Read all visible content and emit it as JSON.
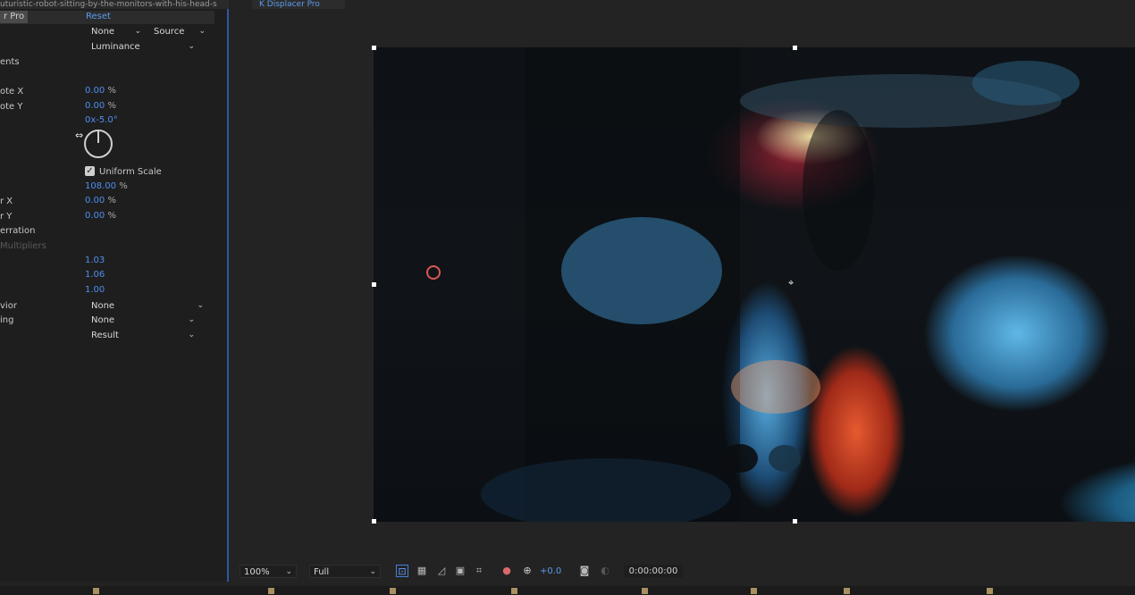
{
  "panel": {
    "filename": "uturistic-robot-sitting-by-the-monitors-with-his-head-s",
    "effect_name": "r Pro",
    "reset_label": "Reset",
    "rows": {
      "layer_select": "None",
      "layer_source": "Source",
      "channel": "Luminance",
      "section_ents": "ents",
      "rotate_x_label": "ote X",
      "rotate_x_value": "0.00",
      "rotate_y_label": "ote Y",
      "rotate_y_value": "0.00",
      "rotation_value": "0x-5.0°",
      "uniform_scale_label": "Uniform Scale",
      "scale_value": "108.00",
      "offset_x_label": "r X",
      "offset_x_value": "0.00",
      "offset_y_label": "r Y",
      "offset_y_value": "0.00",
      "aberration_label": "erration",
      "multipliers_label": "Multipliers",
      "mult_1": "1.03",
      "mult_2": "1.06",
      "mult_3": "1.00",
      "behavior_label": "vior",
      "behavior_value": "None",
      "blending_label": "ing",
      "blending_value": "None",
      "output_value": "Result",
      "percent_unit": "%"
    }
  },
  "viewer": {
    "tab_label": "K Displacer Pro"
  },
  "toolbar": {
    "zoom": "100%",
    "resolution": "Full",
    "exposure_offset": "+0.0",
    "timecode": "0:00:00:00"
  },
  "icons": {
    "dropdown": "chevron-down-icon",
    "checkbox": "checkmark-icon"
  },
  "colors": {
    "accent_blue": "#4f8ff0",
    "panel_border": "#2d5a9e"
  }
}
